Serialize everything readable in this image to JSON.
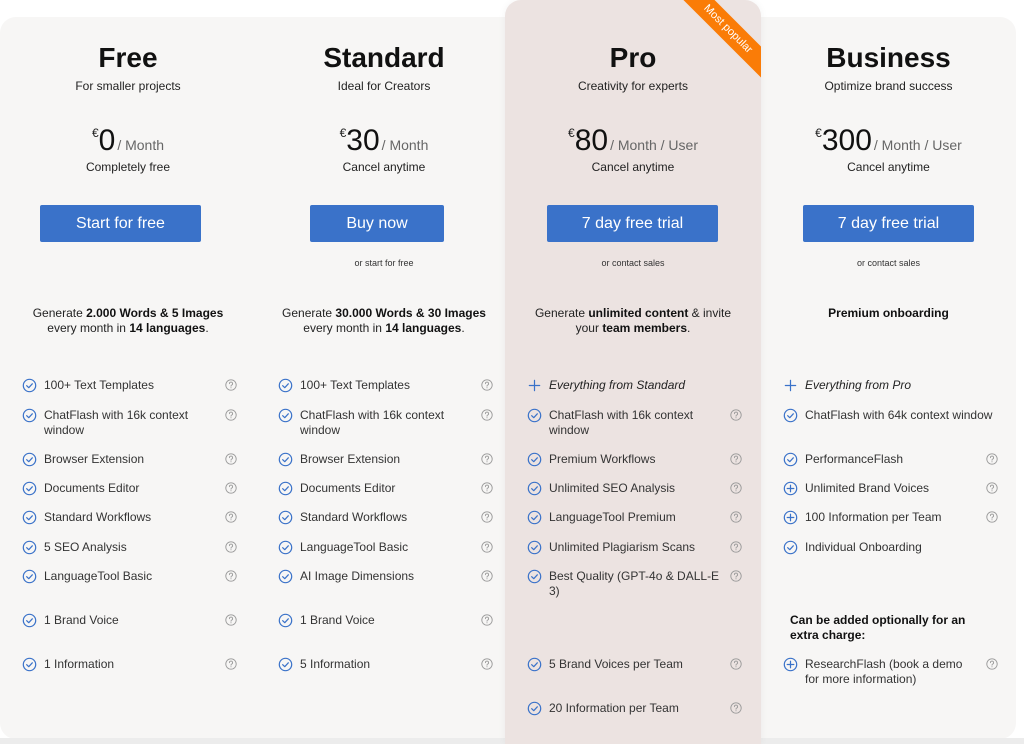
{
  "badge": "Most popular",
  "colors": {
    "accent": "#3a72c9",
    "ribbon": "#fa7c07",
    "pro_bg": "#ece3e1",
    "panel_bg": "#f7f6f5"
  },
  "plans": [
    {
      "name": "Free",
      "tagline": "For smaller projects",
      "currency": "€",
      "price": "0",
      "period": "/  Month",
      "note": "Completely free",
      "cta": "Start for free",
      "alt": "",
      "desc_parts": [
        "Generate ",
        "2.000 Words & 5 Images",
        " every month in ",
        "14 languages",
        "."
      ],
      "features": [
        {
          "icon": "check-circle-icon",
          "text": "100+ Text Templates",
          "help": true
        },
        {
          "icon": "check-circle-icon",
          "text": "ChatFlash with 16k context window",
          "help": true
        },
        {
          "icon": "check-circle-icon",
          "text": "Browser Extension",
          "help": true
        },
        {
          "icon": "check-circle-icon",
          "text": "Documents Editor",
          "help": true
        },
        {
          "icon": "check-circle-icon",
          "text": "Standard Workflows",
          "help": true
        },
        {
          "icon": "check-circle-icon",
          "text": "5 SEO Analysis",
          "help": true
        },
        {
          "icon": "check-circle-icon",
          "text": "LanguageTool Basic",
          "help": true
        },
        {
          "icon": "check-circle-icon",
          "text": "1 Brand Voice",
          "help": true
        },
        {
          "icon": "check-circle-icon",
          "text": "1 Information",
          "help": true
        }
      ]
    },
    {
      "name": "Standard",
      "tagline": "Ideal for Creators",
      "currency": "€",
      "price": "30",
      "period": "/  Month",
      "note": "Cancel anytime",
      "cta": "Buy now",
      "alt": "or start for free",
      "desc_parts": [
        "Generate ",
        "30.000 Words & 30 Images",
        " every month in ",
        "14 languages",
        "."
      ],
      "features": [
        {
          "icon": "check-circle-icon",
          "text": "100+ Text Templates",
          "help": true
        },
        {
          "icon": "check-circle-icon",
          "text": "ChatFlash with 16k context window",
          "help": true
        },
        {
          "icon": "check-circle-icon",
          "text": "Browser Extension",
          "help": true
        },
        {
          "icon": "check-circle-icon",
          "text": "Documents Editor",
          "help": true
        },
        {
          "icon": "check-circle-icon",
          "text": "Standard Workflows",
          "help": true
        },
        {
          "icon": "check-circle-icon",
          "text": "LanguageTool Basic",
          "help": true
        },
        {
          "icon": "check-circle-icon",
          "text": "AI Image Dimensions",
          "help": true
        },
        {
          "icon": "check-circle-icon",
          "text": "1 Brand Voice",
          "help": true
        },
        {
          "icon": "check-circle-icon",
          "text": "5 Information",
          "help": true
        }
      ]
    },
    {
      "name": "Pro",
      "tagline": "Creativity for experts",
      "currency": "€",
      "price": "80",
      "period": "/  Month / User",
      "note": "Cancel anytime",
      "cta": "7 day free trial",
      "alt": "or contact sales",
      "desc_parts": [
        "Generate ",
        "unlimited content",
        " & invite your ",
        "team members",
        "."
      ],
      "features": [
        {
          "icon": "plus-icon",
          "text": "Everything from Standard",
          "help": false,
          "italic": true
        },
        {
          "icon": "check-circle-icon",
          "text": "ChatFlash with 16k context window",
          "help": true
        },
        {
          "icon": "check-circle-icon",
          "text": "Premium Workflows",
          "help": true
        },
        {
          "icon": "check-circle-icon",
          "text": "Unlimited SEO Analysis",
          "help": true
        },
        {
          "icon": "check-circle-icon",
          "text": "LanguageTool Premium",
          "help": true
        },
        {
          "icon": "check-circle-icon",
          "text": "Unlimited Plagiarism Scans",
          "help": true
        },
        {
          "icon": "check-circle-icon",
          "text": "Best Quality (GPT-4o & DALL-E 3)",
          "help": true
        },
        {
          "icon": "check-circle-icon",
          "text": "5 Brand Voices per Team",
          "help": true
        },
        {
          "icon": "check-circle-icon",
          "text": "20 Information per Team",
          "help": true
        }
      ]
    },
    {
      "name": "Business",
      "tagline": "Optimize brand success",
      "currency": "€",
      "price": "300",
      "period": "/  Month / User",
      "note": "Cancel anytime",
      "cta": "7 day free trial",
      "alt": "or contact sales",
      "desc_parts": [
        "",
        "Premium onboarding",
        "",
        "",
        ""
      ],
      "features": [
        {
          "icon": "plus-icon",
          "text": "Everything from Pro",
          "help": false,
          "italic": true
        },
        {
          "icon": "check-circle-icon",
          "text": "ChatFlash with 64k context window",
          "help": false
        },
        {
          "icon": "check-circle-icon",
          "text": "PerformanceFlash",
          "help": true
        },
        {
          "icon": "plus-circle-icon",
          "text": "Unlimited Brand Voices",
          "help": true
        },
        {
          "icon": "plus-circle-icon",
          "text": "100 Information per Team",
          "help": true
        },
        {
          "icon": "check-circle-icon",
          "text": "Individual Onboarding",
          "help": false
        }
      ],
      "extra_heading": "Can be added optionally for an extra charge:",
      "extra_features": [
        {
          "icon": "plus-circle-icon",
          "text": "ResearchFlash (book a demo for more information)",
          "help": true
        }
      ]
    }
  ]
}
